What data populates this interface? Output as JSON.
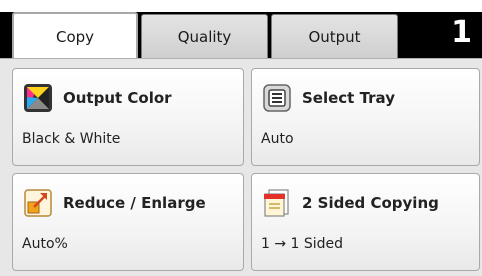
{
  "tabs": [
    {
      "label": "Copy",
      "active": true
    },
    {
      "label": "Quality",
      "active": false
    },
    {
      "label": "Output",
      "active": false
    }
  ],
  "page_number": "1",
  "tiles": [
    {
      "title": "Output Color",
      "value": "Black & White",
      "icon": "output-color-icon"
    },
    {
      "title": "Select Tray",
      "value": "Auto",
      "icon": "select-tray-icon"
    },
    {
      "title": "Reduce / Enlarge",
      "value": "Auto%",
      "icon": "reduce-enlarge-icon"
    },
    {
      "title": "2 Sided Copying",
      "value": "1 → 1 Sided",
      "icon": "two-sided-copy-icon"
    }
  ]
}
